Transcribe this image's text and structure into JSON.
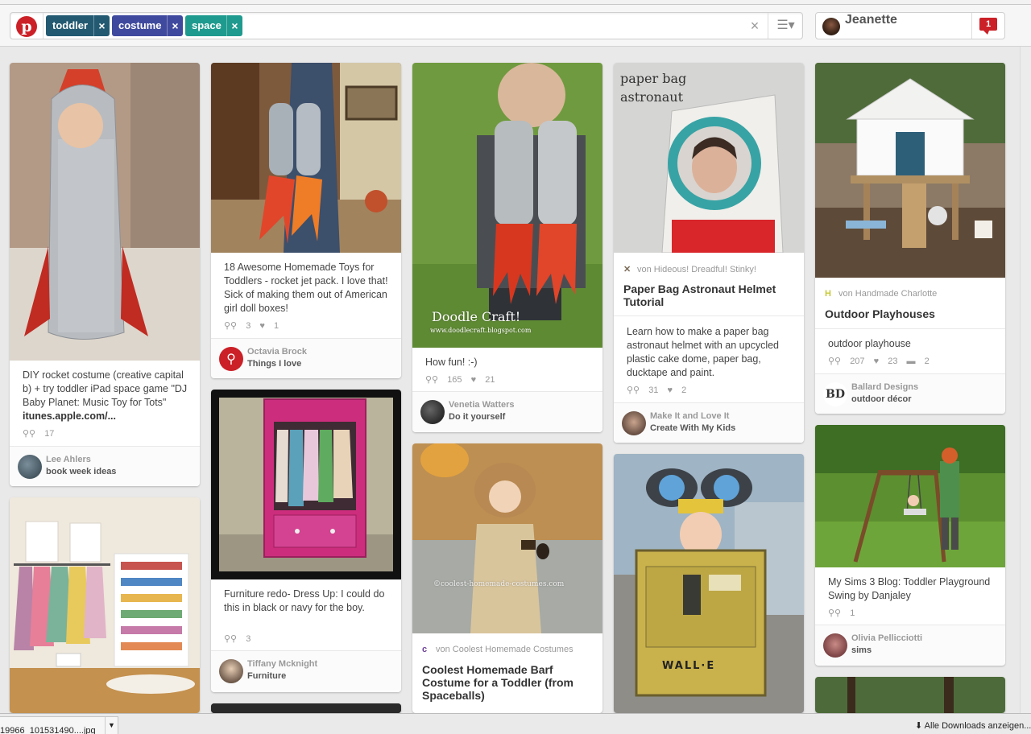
{
  "search": {
    "tags": [
      {
        "label": "toddler",
        "color": "#235a72"
      },
      {
        "label": "costume",
        "color": "#3f4a9e"
      },
      {
        "label": "space",
        "color": "#1f9a8e"
      }
    ],
    "clear_icon": "×",
    "remove_icon": "×"
  },
  "user": {
    "name": "Jeanette",
    "notifications": "1"
  },
  "pins": {
    "p1": {
      "desc_text": "DIY rocket costume (creative capital b) + try toddler iPad space game \"DJ Baby Planet: Music Toy for Tots\" ",
      "desc_link": "itunes.apple.com/...",
      "repins": "17",
      "pinner": "Lee Ahlers",
      "board": "book week ideas"
    },
    "p2": {
      "desc": "18 Awesome Homemade Toys for Toddlers - rocket jet pack. I love that! Sick of making them out of American girl doll boxes!",
      "repins": "3",
      "likes": "1",
      "pinner": "Octavia Brock",
      "board": "Things I love"
    },
    "p3": {
      "desc": "Furniture redo- Dress Up: I could do this in black or navy for the boy.",
      "repins": "3",
      "pinner": "Tiffany Mcknight",
      "board": "Furniture"
    },
    "p4": {
      "overlay_line1": "Doodle Craft!",
      "overlay_line2": "www.doodlecraft.blogspot.com",
      "desc": "How fun! :-)",
      "repins": "165",
      "likes": "21",
      "pinner": "Venetia Watters",
      "board": "Do it yourself"
    },
    "p5": {
      "overlay": "©coolest-homemade-costumes.com",
      "via": "von Coolest Homemade Costumes",
      "title": "Coolest Homemade Barf Costume for a Toddler (from Spaceballs)"
    },
    "p6": {
      "overlay_line1": "paper bag",
      "overlay_line2": "astronaut",
      "via": "von Hideous! Dreadful! Stinky!",
      "title": "Paper Bag Astronaut Helmet Tutorial",
      "desc": "Learn how to make a paper bag astronaut helmet with an upcycled plastic cake dome, paper bag, ducktape and paint.",
      "repins": "31",
      "likes": "2",
      "pinner": "Make It and Love It",
      "board": "Create With My Kids"
    },
    "p7": {
      "overlay": "WALL·E"
    },
    "p8": {
      "via": "von Handmade Charlotte",
      "title": "Outdoor Playhouses",
      "desc": "outdoor playhouse",
      "repins": "207",
      "likes": "23",
      "comments": "2",
      "pinner": "Ballard Designs",
      "board": "outdoor décor",
      "logo_text": "BD"
    },
    "p9": {
      "desc": "My Sims 3 Blog: Toddler Playground Swing by Danjaley",
      "repins": "1",
      "pinner": "Olivia Pellicciotti",
      "board": "sims"
    }
  },
  "downloads": {
    "file": "19966_101531490....jpg",
    "show_all": "Alle Downloads anzeigen..."
  }
}
